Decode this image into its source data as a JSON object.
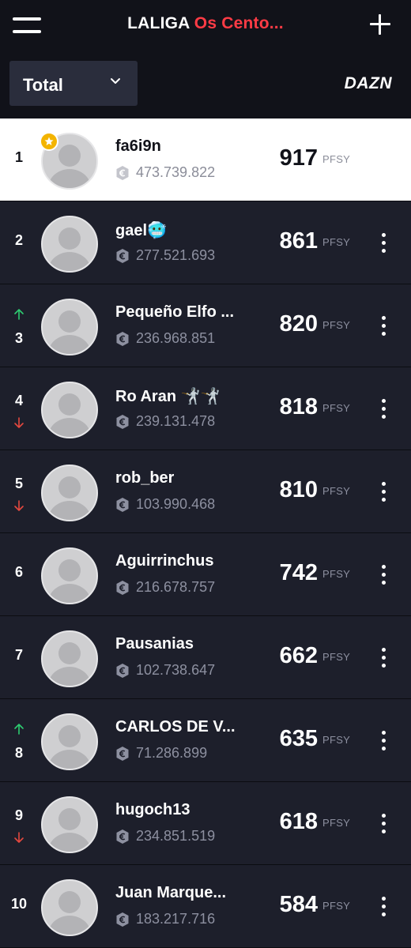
{
  "header": {
    "title_brand": "LALIGA",
    "title_league": "Os Cento...",
    "filter_label": "Total",
    "partner_logo": "DAZN"
  },
  "icons": {
    "menu": "hamburger-menu-icon",
    "add": "plus-icon",
    "dropdown": "chevron-down-icon",
    "coin": "euro-coin-icon",
    "more": "more-vertical-icon",
    "up": "arrow-up-icon",
    "down": "arrow-down-icon",
    "captain": "star-badge-icon"
  },
  "colors": {
    "accent_red": "#ff3b45",
    "up_green": "#2ecc71",
    "down_red": "#e5483f",
    "background": "#1d1f2b",
    "highlight_row": "#ffffff"
  },
  "units": {
    "points": "PFSY"
  },
  "standings": [
    {
      "rank": "1",
      "name": "fa6i9n",
      "money": "473.739.822",
      "points": "917",
      "trend": "none",
      "is_user": true
    },
    {
      "rank": "2",
      "name": "gael🥶",
      "money": "277.521.693",
      "points": "861",
      "trend": "none",
      "is_user": false
    },
    {
      "rank": "3",
      "name": "Pequeño Elfo ...",
      "money": "236.968.851",
      "points": "820",
      "trend": "up",
      "is_user": false
    },
    {
      "rank": "4",
      "name": "Ro Aran 🤺🤺",
      "money": "239.131.478",
      "points": "818",
      "trend": "down",
      "is_user": false
    },
    {
      "rank": "5",
      "name": "rob_ber",
      "money": "103.990.468",
      "points": "810",
      "trend": "down",
      "is_user": false
    },
    {
      "rank": "6",
      "name": "Aguirrinchus",
      "money": "216.678.757",
      "points": "742",
      "trend": "none",
      "is_user": false
    },
    {
      "rank": "7",
      "name": "Pausanias",
      "money": "102.738.647",
      "points": "662",
      "trend": "none",
      "is_user": false
    },
    {
      "rank": "8",
      "name": "CARLOS DE V...",
      "money": "71.286.899",
      "points": "635",
      "trend": "up",
      "is_user": false
    },
    {
      "rank": "9",
      "name": "hugoch13",
      "money": "234.851.519",
      "points": "618",
      "trend": "down",
      "is_user": false
    },
    {
      "rank": "10",
      "name": "Juan Marque...",
      "money": "183.217.716",
      "points": "584",
      "trend": "none",
      "is_user": false
    }
  ]
}
